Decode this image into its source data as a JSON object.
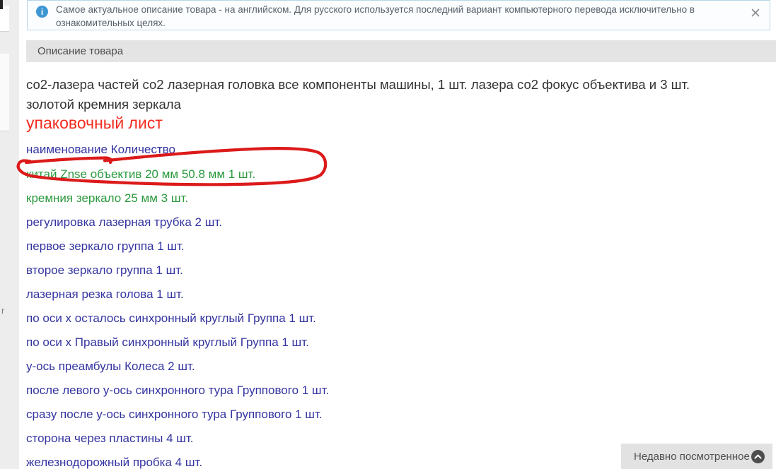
{
  "banner": {
    "lines": [
      "Самое актуальное описание товара - на английском. Для русского используется последний вариант компьютерного перевода исключительно в",
      "ознакомительных целях."
    ],
    "info_icon_glyph": "i"
  },
  "tab_bar": {
    "title": "Описание товара"
  },
  "content": {
    "intro_lines": [
      "со2-лазера частей со2 лазерная головка все компоненты машины, 1 шт. лазера со2 фокус объектива и 3 шт.",
      "золотой кремния зеркала"
    ],
    "packing_title": "упаковочный лист",
    "list_header": "наименование Количество",
    "items": [
      {
        "text": "китай Znse объектив 20 мм 50.8 мм 1 шт.",
        "color": "green",
        "annotated": true
      },
      {
        "text": "кремния зеркало 25 мм 3 шт.",
        "color": "green",
        "annotated": false
      },
      {
        "text": "регулировка лазерная трубка 2 шт.",
        "color": "navy",
        "annotated": false
      },
      {
        "text": "первое зеркало группа 1 шт.",
        "color": "navy",
        "annotated": false
      },
      {
        "text": "второе зеркало группа 1 шт.",
        "color": "navy",
        "annotated": false
      },
      {
        "text": "лазерная резка голова 1 шт.",
        "color": "navy",
        "annotated": false
      },
      {
        "text": "по оси x осталось синхронный круглый Группа 1 шт.",
        "color": "navy",
        "annotated": false
      },
      {
        "text": "по оси x Правый синхронный круглый Группа 1 шт.",
        "color": "navy",
        "annotated": false
      },
      {
        "text": "у-ось преамбулы Колеса 2 шт.",
        "color": "navy",
        "annotated": false
      },
      {
        "text": "после левого у-ось синхронного тура Группового 1 шт.",
        "color": "navy",
        "annotated": false
      },
      {
        "text": "сразу после у-ось синхронного тура Группового 1 шт.",
        "color": "navy",
        "annotated": false
      },
      {
        "text": "сторона через пластины 4 шт.",
        "color": "navy",
        "annotated": false
      },
      {
        "text": "железнодорожный пробка 4 шт.",
        "color": "navy",
        "annotated": false
      }
    ]
  },
  "recently_viewed": {
    "label": "Недавно посмотренное"
  },
  "page_edge": {
    "fragment_text": "r"
  },
  "colors": {
    "item_green": "#2b9a3e",
    "item_navy": "#3434a2",
    "heading_red": "#f32b1e",
    "annotation_red": "#dc1a1a",
    "info_blue": "#3e96d2",
    "banner_border": "#b7d7e9",
    "tabbar_gray": "#e4e4e4"
  }
}
